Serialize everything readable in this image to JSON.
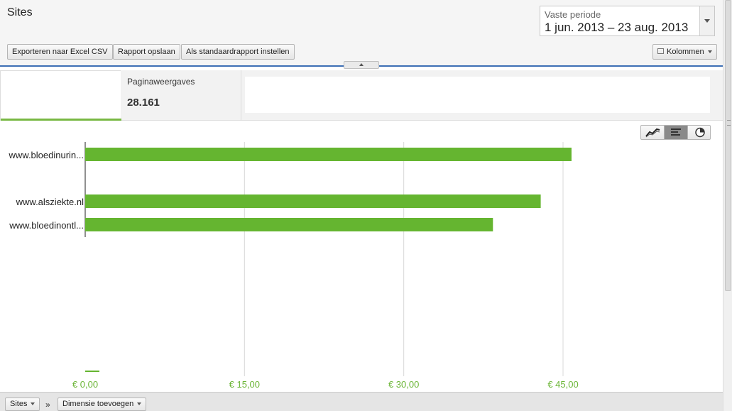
{
  "header": {
    "title": "Sites",
    "period_label": "Vaste periode",
    "period_value": "1 jun. 2013 – 23 aug. 2013"
  },
  "toolbar": {
    "export_label": "Exporteren naar Excel CSV",
    "save_label": "Rapport opslaan",
    "default_label": "Als standaardrapport instellen",
    "columns_label": "Kolommen"
  },
  "metric": {
    "label": "Paginaweergaves",
    "value": "28.161"
  },
  "chart_data": {
    "type": "bar",
    "orientation": "horizontal",
    "categories": [
      "www.bloedinurin...",
      "",
      "www.alsziekte.nl",
      "www.bloedinontl..."
    ],
    "values": [
      45.8,
      null,
      42.9,
      38.4
    ],
    "xticks": [
      "€ 0,00",
      "€ 15,00",
      "€ 30,00",
      "€ 45,00"
    ],
    "xlim": [
      0,
      60
    ],
    "grid": true,
    "bar_color": "#65b530"
  },
  "footer": {
    "sites_label": "Sites",
    "separator": "»",
    "add_dimension_label": "Dimensie toevoegen"
  },
  "icons": {
    "line": "line-chart-icon",
    "bar": "bar-chart-icon",
    "pie": "pie-chart-icon"
  },
  "colors": {
    "accent": "#78b843",
    "tick_text": "#6bb536",
    "divider": "#3d6fb5"
  }
}
